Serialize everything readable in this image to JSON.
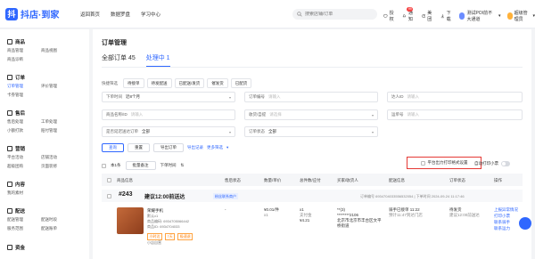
{
  "brand": {
    "name": "抖店·到家",
    "mark": "抖"
  },
  "topnav": [
    "返回首页",
    "数据罗盘",
    "学习中心"
  ],
  "search": {
    "placeholder": "搜索店铺/订单"
  },
  "top_actions": {
    "ops": "授权",
    "notice": "通知",
    "notice_badge": "99",
    "schedule": "美团",
    "download": "下载"
  },
  "store": {
    "name": "测试POI前不大通道",
    "user": "超级管理员"
  },
  "sidebar": [
    {
      "title": "商品",
      "items": [
        "商品管理",
        "商品视图",
        "商品诊断"
      ]
    },
    {
      "title": "订单",
      "items": [
        "订单管理",
        "评价管理",
        "卡券管理"
      ]
    },
    {
      "title": "售后",
      "items": [
        "售后处理",
        "工单处理",
        "小额打款",
        "赔付管理"
      ]
    },
    {
      "title": "营销",
      "items": [
        "平台活动",
        "店铺活动",
        "超级团购",
        "页面装修"
      ]
    },
    {
      "title": "内容",
      "items": [
        "我的素材"
      ]
    },
    {
      "title": "配送",
      "items": [
        "配送管理",
        "配送时段",
        "服务范围",
        "配送账单"
      ]
    },
    {
      "title": "资金",
      "items": []
    }
  ],
  "page": {
    "title": "订单管理",
    "tabs": [
      {
        "label": "全部订单 45"
      },
      {
        "label": "处理中 1"
      }
    ]
  },
  "quick_filter": {
    "label": "快捷筛选",
    "chips": [
      "待接单",
      "待发配送",
      "已配送/发货",
      "催发货",
      "已配货"
    ]
  },
  "filters": {
    "order_time_label": "下单时间",
    "order_time_value": "近8个月",
    "order_no_label": "订单编号",
    "order_no_ph": "请输入",
    "buyer_label": "达人ID",
    "buyer_ph": "请输入",
    "goods_label": "商品名称/ID",
    "goods_ph": "请输入",
    "phone_label": "手机号码",
    "phone_ph": "请输入",
    "receiver_label": "收货/自提",
    "receiver_ph": "请选择",
    "delivery_label": "运单号",
    "delivery_ph": "请输入",
    "ship_label": "是否延迟送达订单",
    "ship_value": "全部",
    "status_label": "订单状态",
    "status_value": "全部"
  },
  "buttons": {
    "query": "查询",
    "reset": "重置",
    "export": "导出订单",
    "export_log": "导出记录",
    "more": "更多筛选"
  },
  "toolbar": {
    "select_all": "本1条",
    "batch_note": "批量备注",
    "sort": "下单时间"
  },
  "print_settings": {
    "label": "平台出力打印格式设置"
  },
  "auto_print": {
    "label": "自动打印小票"
  },
  "table_headers": [
    "商品信息",
    "售后状态",
    "数量/单价",
    "总件数/应付",
    "买家/收货人",
    "配送信息",
    "订单状态",
    "操作"
  ],
  "order": {
    "number": "#243",
    "time": "建议12:00前送达",
    "tag": "粉丝联系商户",
    "meta": "订单编号 6934704033556532054 | 下单时间 2024-09-24 11:17:46",
    "product_name": "荣耀手机",
    "product_spec": "默认x1",
    "product_code": "商品编码: 6934705066442",
    "product_id": "商品ID: 6934704033",
    "product_tags": [
      "小时达",
      "7天",
      "极速退"
    ],
    "product_shop": "小店自营",
    "aftersale": "-",
    "unit_price": "¥0.01/件",
    "qty": "x1",
    "total": "x1",
    "total_label": "支付金",
    "paid": "¥4.21",
    "buyer_name": "**(3)",
    "buyer_phone": "********2106",
    "buyer_addr": "北京市北京市丰台区文平",
    "buyer_detail": "桥街道",
    "delivery_title": "骑手已接单 11:22",
    "delivery_sub": "预计11:47到达门店",
    "status": "待发货",
    "status_sub": "建议12:00前送达",
    "actions": [
      "上报异常情况",
      "打印小票",
      "联系骑手",
      "联系运力"
    ]
  }
}
